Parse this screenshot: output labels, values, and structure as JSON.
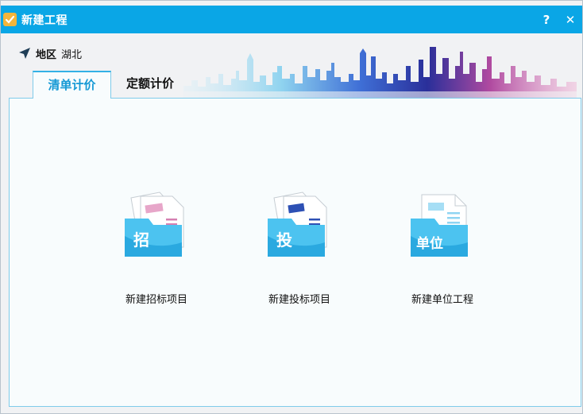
{
  "window": {
    "title": "新建工程"
  },
  "titlebar": {
    "help_label": "?",
    "close_label": "✕"
  },
  "region": {
    "label": "地区",
    "value": "湖北"
  },
  "tabs": [
    {
      "label": "清单计价",
      "active": true
    },
    {
      "label": "定额计价",
      "active": false
    }
  ],
  "cards": [
    {
      "icon": "bid-invite-folder-icon",
      "glyph": "招",
      "label": "新建招标项目"
    },
    {
      "icon": "bid-submit-folder-icon",
      "glyph": "投",
      "label": "新建投标项目"
    },
    {
      "icon": "unit-project-folder-icon",
      "glyph": "单位",
      "label": "新建单位工程"
    }
  ],
  "colors": {
    "titlebar": "#0aa6e6",
    "accent": "#1599d5",
    "folder": "#4cc3f0",
    "folder_dark": "#2aa9e0"
  }
}
